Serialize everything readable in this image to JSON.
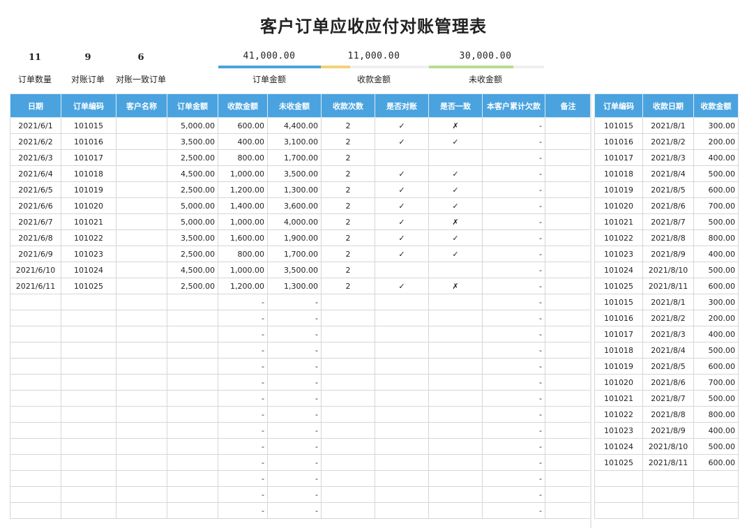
{
  "title": "客户订单应收应付对账管理表",
  "summary": {
    "order_count": "11",
    "order_count_label": "订单数量",
    "reconciled": "9",
    "reconciled_label": "对账订单",
    "consistent": "6",
    "consistent_label": "对账一致订单",
    "order_amount": "41,000.00",
    "order_amount_label": "订单金额",
    "received_amount": "11,000.00",
    "received_amount_label": "收款金额",
    "unreceived_amount": "30,000.00",
    "unreceived_amount_label": "未收金额"
  },
  "progress": {
    "order_amount": 1.0,
    "received_amount": 0.268,
    "unreceived_amount": 0.732
  },
  "colors": {
    "header": "#4aa3df",
    "order_bar": "#4aa3df",
    "received_bar": "#f2d276",
    "unreceived_bar": "#b7dd8f"
  },
  "main_table": {
    "headers": [
      "日期",
      "订单编码",
      "客户名称",
      "订单金额",
      "收款金额",
      "未收金额",
      "收款次数",
      "是否对账",
      "是否一致",
      "本客户累计欠款",
      "备注"
    ],
    "rows": [
      [
        "2021/6/1",
        "101015",
        "",
        "5,000.00",
        "600.00",
        "4,400.00",
        "2",
        "✓",
        "✗",
        "-",
        ""
      ],
      [
        "2021/6/2",
        "101016",
        "",
        "3,500.00",
        "400.00",
        "3,100.00",
        "2",
        "✓",
        "✓",
        "-",
        ""
      ],
      [
        "2021/6/3",
        "101017",
        "",
        "2,500.00",
        "800.00",
        "1,700.00",
        "2",
        "",
        "",
        "-",
        ""
      ],
      [
        "2021/6/4",
        "101018",
        "",
        "4,500.00",
        "1,000.00",
        "3,500.00",
        "2",
        "✓",
        "✓",
        "-",
        ""
      ],
      [
        "2021/6/5",
        "101019",
        "",
        "2,500.00",
        "1,200.00",
        "1,300.00",
        "2",
        "✓",
        "✓",
        "-",
        ""
      ],
      [
        "2021/6/6",
        "101020",
        "",
        "5,000.00",
        "1,400.00",
        "3,600.00",
        "2",
        "✓",
        "✓",
        "-",
        ""
      ],
      [
        "2021/6/7",
        "101021",
        "",
        "5,000.00",
        "1,000.00",
        "4,000.00",
        "2",
        "✓",
        "✗",
        "-",
        ""
      ],
      [
        "2021/6/8",
        "101022",
        "",
        "3,500.00",
        "1,600.00",
        "1,900.00",
        "2",
        "✓",
        "✓",
        "-",
        ""
      ],
      [
        "2021/6/9",
        "101023",
        "",
        "2,500.00",
        "800.00",
        "1,700.00",
        "2",
        "✓",
        "✓",
        "-",
        ""
      ],
      [
        "2021/6/10",
        "101024",
        "",
        "4,500.00",
        "1,000.00",
        "3,500.00",
        "2",
        "",
        "",
        "-",
        ""
      ],
      [
        "2021/6/11",
        "101025",
        "",
        "2,500.00",
        "1,200.00",
        "1,300.00",
        "2",
        "✓",
        "✗",
        "-",
        ""
      ],
      [
        "",
        "",
        "",
        "",
        "-",
        "-",
        "",
        "",
        "",
        "-",
        ""
      ],
      [
        "",
        "",
        "",
        "",
        "-",
        "-",
        "",
        "",
        "",
        "-",
        ""
      ],
      [
        "",
        "",
        "",
        "",
        "-",
        "-",
        "",
        "",
        "",
        "-",
        ""
      ],
      [
        "",
        "",
        "",
        "",
        "-",
        "-",
        "",
        "",
        "",
        "-",
        ""
      ],
      [
        "",
        "",
        "",
        "",
        "-",
        "-",
        "",
        "",
        "",
        "-",
        ""
      ],
      [
        "",
        "",
        "",
        "",
        "-",
        "-",
        "",
        "",
        "",
        "-",
        ""
      ],
      [
        "",
        "",
        "",
        "",
        "-",
        "-",
        "",
        "",
        "",
        "-",
        ""
      ],
      [
        "",
        "",
        "",
        "",
        "-",
        "-",
        "",
        "",
        "",
        "-",
        ""
      ],
      [
        "",
        "",
        "",
        "",
        "-",
        "-",
        "",
        "",
        "",
        "-",
        ""
      ],
      [
        "",
        "",
        "",
        "",
        "-",
        "-",
        "",
        "",
        "",
        "-",
        ""
      ],
      [
        "",
        "",
        "",
        "",
        "-",
        "-",
        "",
        "",
        "",
        "-",
        ""
      ],
      [
        "",
        "",
        "",
        "",
        "-",
        "-",
        "",
        "",
        "",
        "-",
        ""
      ],
      [
        "",
        "",
        "",
        "",
        "-",
        "-",
        "",
        "",
        "",
        "-",
        ""
      ],
      [
        "",
        "",
        "",
        "",
        "-",
        "-",
        "",
        "",
        "",
        "-",
        ""
      ]
    ]
  },
  "side_table": {
    "headers": [
      "订单编码",
      "收款日期",
      "收款金额"
    ],
    "rows": [
      [
        "101015",
        "2021/8/1",
        "300.00"
      ],
      [
        "101016",
        "2021/8/2",
        "200.00"
      ],
      [
        "101017",
        "2021/8/3",
        "400.00"
      ],
      [
        "101018",
        "2021/8/4",
        "500.00"
      ],
      [
        "101019",
        "2021/8/5",
        "600.00"
      ],
      [
        "101020",
        "2021/8/6",
        "700.00"
      ],
      [
        "101021",
        "2021/8/7",
        "500.00"
      ],
      [
        "101022",
        "2021/8/8",
        "800.00"
      ],
      [
        "101023",
        "2021/8/9",
        "400.00"
      ],
      [
        "101024",
        "2021/8/10",
        "500.00"
      ],
      [
        "101025",
        "2021/8/11",
        "600.00"
      ],
      [
        "101015",
        "2021/8/1",
        "300.00"
      ],
      [
        "101016",
        "2021/8/2",
        "200.00"
      ],
      [
        "101017",
        "2021/8/3",
        "400.00"
      ],
      [
        "101018",
        "2021/8/4",
        "500.00"
      ],
      [
        "101019",
        "2021/8/5",
        "600.00"
      ],
      [
        "101020",
        "2021/8/6",
        "700.00"
      ],
      [
        "101021",
        "2021/8/7",
        "500.00"
      ],
      [
        "101022",
        "2021/8/8",
        "800.00"
      ],
      [
        "101023",
        "2021/8/9",
        "400.00"
      ],
      [
        "101024",
        "2021/8/10",
        "500.00"
      ],
      [
        "101025",
        "2021/8/11",
        "600.00"
      ],
      [
        "",
        "",
        ""
      ],
      [
        "",
        "",
        ""
      ],
      [
        "",
        "",
        ""
      ]
    ]
  }
}
